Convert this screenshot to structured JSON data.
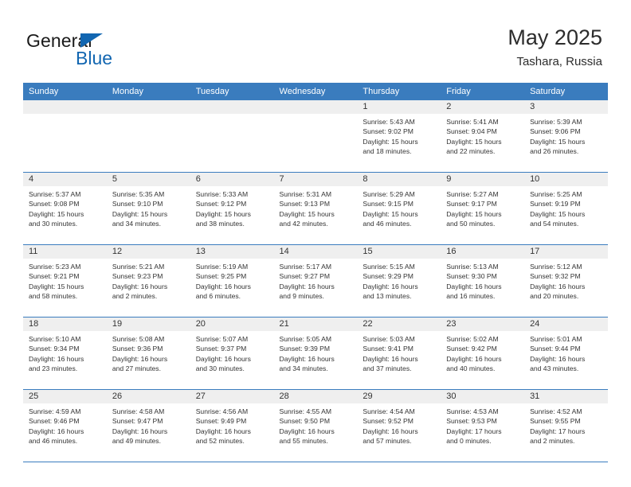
{
  "brand": {
    "name_part1": "General",
    "name_part2": "Blue",
    "triangle_color": "#1266b1"
  },
  "header": {
    "month_title": "May 2025",
    "location": "Tashara, Russia"
  },
  "theme": {
    "header_row_bg": "#3a7cbe",
    "daynum_bg": "#efefef",
    "text_color": "#333333",
    "accent": "#1266b1"
  },
  "calendar": {
    "weekday_headers": [
      "Sunday",
      "Monday",
      "Tuesday",
      "Wednesday",
      "Thursday",
      "Friday",
      "Saturday"
    ],
    "weeks": [
      [
        {
          "day": "",
          "lines": []
        },
        {
          "day": "",
          "lines": []
        },
        {
          "day": "",
          "lines": []
        },
        {
          "day": "",
          "lines": []
        },
        {
          "day": "1",
          "lines": [
            "Sunrise: 5:43 AM",
            "Sunset: 9:02 PM",
            "Daylight: 15 hours",
            "and 18 minutes."
          ]
        },
        {
          "day": "2",
          "lines": [
            "Sunrise: 5:41 AM",
            "Sunset: 9:04 PM",
            "Daylight: 15 hours",
            "and 22 minutes."
          ]
        },
        {
          "day": "3",
          "lines": [
            "Sunrise: 5:39 AM",
            "Sunset: 9:06 PM",
            "Daylight: 15 hours",
            "and 26 minutes."
          ]
        }
      ],
      [
        {
          "day": "4",
          "lines": [
            "Sunrise: 5:37 AM",
            "Sunset: 9:08 PM",
            "Daylight: 15 hours",
            "and 30 minutes."
          ]
        },
        {
          "day": "5",
          "lines": [
            "Sunrise: 5:35 AM",
            "Sunset: 9:10 PM",
            "Daylight: 15 hours",
            "and 34 minutes."
          ]
        },
        {
          "day": "6",
          "lines": [
            "Sunrise: 5:33 AM",
            "Sunset: 9:12 PM",
            "Daylight: 15 hours",
            "and 38 minutes."
          ]
        },
        {
          "day": "7",
          "lines": [
            "Sunrise: 5:31 AM",
            "Sunset: 9:13 PM",
            "Daylight: 15 hours",
            "and 42 minutes."
          ]
        },
        {
          "day": "8",
          "lines": [
            "Sunrise: 5:29 AM",
            "Sunset: 9:15 PM",
            "Daylight: 15 hours",
            "and 46 minutes."
          ]
        },
        {
          "day": "9",
          "lines": [
            "Sunrise: 5:27 AM",
            "Sunset: 9:17 PM",
            "Daylight: 15 hours",
            "and 50 minutes."
          ]
        },
        {
          "day": "10",
          "lines": [
            "Sunrise: 5:25 AM",
            "Sunset: 9:19 PM",
            "Daylight: 15 hours",
            "and 54 minutes."
          ]
        }
      ],
      [
        {
          "day": "11",
          "lines": [
            "Sunrise: 5:23 AM",
            "Sunset: 9:21 PM",
            "Daylight: 15 hours",
            "and 58 minutes."
          ]
        },
        {
          "day": "12",
          "lines": [
            "Sunrise: 5:21 AM",
            "Sunset: 9:23 PM",
            "Daylight: 16 hours",
            "and 2 minutes."
          ]
        },
        {
          "day": "13",
          "lines": [
            "Sunrise: 5:19 AM",
            "Sunset: 9:25 PM",
            "Daylight: 16 hours",
            "and 6 minutes."
          ]
        },
        {
          "day": "14",
          "lines": [
            "Sunrise: 5:17 AM",
            "Sunset: 9:27 PM",
            "Daylight: 16 hours",
            "and 9 minutes."
          ]
        },
        {
          "day": "15",
          "lines": [
            "Sunrise: 5:15 AM",
            "Sunset: 9:29 PM",
            "Daylight: 16 hours",
            "and 13 minutes."
          ]
        },
        {
          "day": "16",
          "lines": [
            "Sunrise: 5:13 AM",
            "Sunset: 9:30 PM",
            "Daylight: 16 hours",
            "and 16 minutes."
          ]
        },
        {
          "day": "17",
          "lines": [
            "Sunrise: 5:12 AM",
            "Sunset: 9:32 PM",
            "Daylight: 16 hours",
            "and 20 minutes."
          ]
        }
      ],
      [
        {
          "day": "18",
          "lines": [
            "Sunrise: 5:10 AM",
            "Sunset: 9:34 PM",
            "Daylight: 16 hours",
            "and 23 minutes."
          ]
        },
        {
          "day": "19",
          "lines": [
            "Sunrise: 5:08 AM",
            "Sunset: 9:36 PM",
            "Daylight: 16 hours",
            "and 27 minutes."
          ]
        },
        {
          "day": "20",
          "lines": [
            "Sunrise: 5:07 AM",
            "Sunset: 9:37 PM",
            "Daylight: 16 hours",
            "and 30 minutes."
          ]
        },
        {
          "day": "21",
          "lines": [
            "Sunrise: 5:05 AM",
            "Sunset: 9:39 PM",
            "Daylight: 16 hours",
            "and 34 minutes."
          ]
        },
        {
          "day": "22",
          "lines": [
            "Sunrise: 5:03 AM",
            "Sunset: 9:41 PM",
            "Daylight: 16 hours",
            "and 37 minutes."
          ]
        },
        {
          "day": "23",
          "lines": [
            "Sunrise: 5:02 AM",
            "Sunset: 9:42 PM",
            "Daylight: 16 hours",
            "and 40 minutes."
          ]
        },
        {
          "day": "24",
          "lines": [
            "Sunrise: 5:01 AM",
            "Sunset: 9:44 PM",
            "Daylight: 16 hours",
            "and 43 minutes."
          ]
        }
      ],
      [
        {
          "day": "25",
          "lines": [
            "Sunrise: 4:59 AM",
            "Sunset: 9:46 PM",
            "Daylight: 16 hours",
            "and 46 minutes."
          ]
        },
        {
          "day": "26",
          "lines": [
            "Sunrise: 4:58 AM",
            "Sunset: 9:47 PM",
            "Daylight: 16 hours",
            "and 49 minutes."
          ]
        },
        {
          "day": "27",
          "lines": [
            "Sunrise: 4:56 AM",
            "Sunset: 9:49 PM",
            "Daylight: 16 hours",
            "and 52 minutes."
          ]
        },
        {
          "day": "28",
          "lines": [
            "Sunrise: 4:55 AM",
            "Sunset: 9:50 PM",
            "Daylight: 16 hours",
            "and 55 minutes."
          ]
        },
        {
          "day": "29",
          "lines": [
            "Sunrise: 4:54 AM",
            "Sunset: 9:52 PM",
            "Daylight: 16 hours",
            "and 57 minutes."
          ]
        },
        {
          "day": "30",
          "lines": [
            "Sunrise: 4:53 AM",
            "Sunset: 9:53 PM",
            "Daylight: 17 hours",
            "and 0 minutes."
          ]
        },
        {
          "day": "31",
          "lines": [
            "Sunrise: 4:52 AM",
            "Sunset: 9:55 PM",
            "Daylight: 17 hours",
            "and 2 minutes."
          ]
        }
      ]
    ]
  }
}
